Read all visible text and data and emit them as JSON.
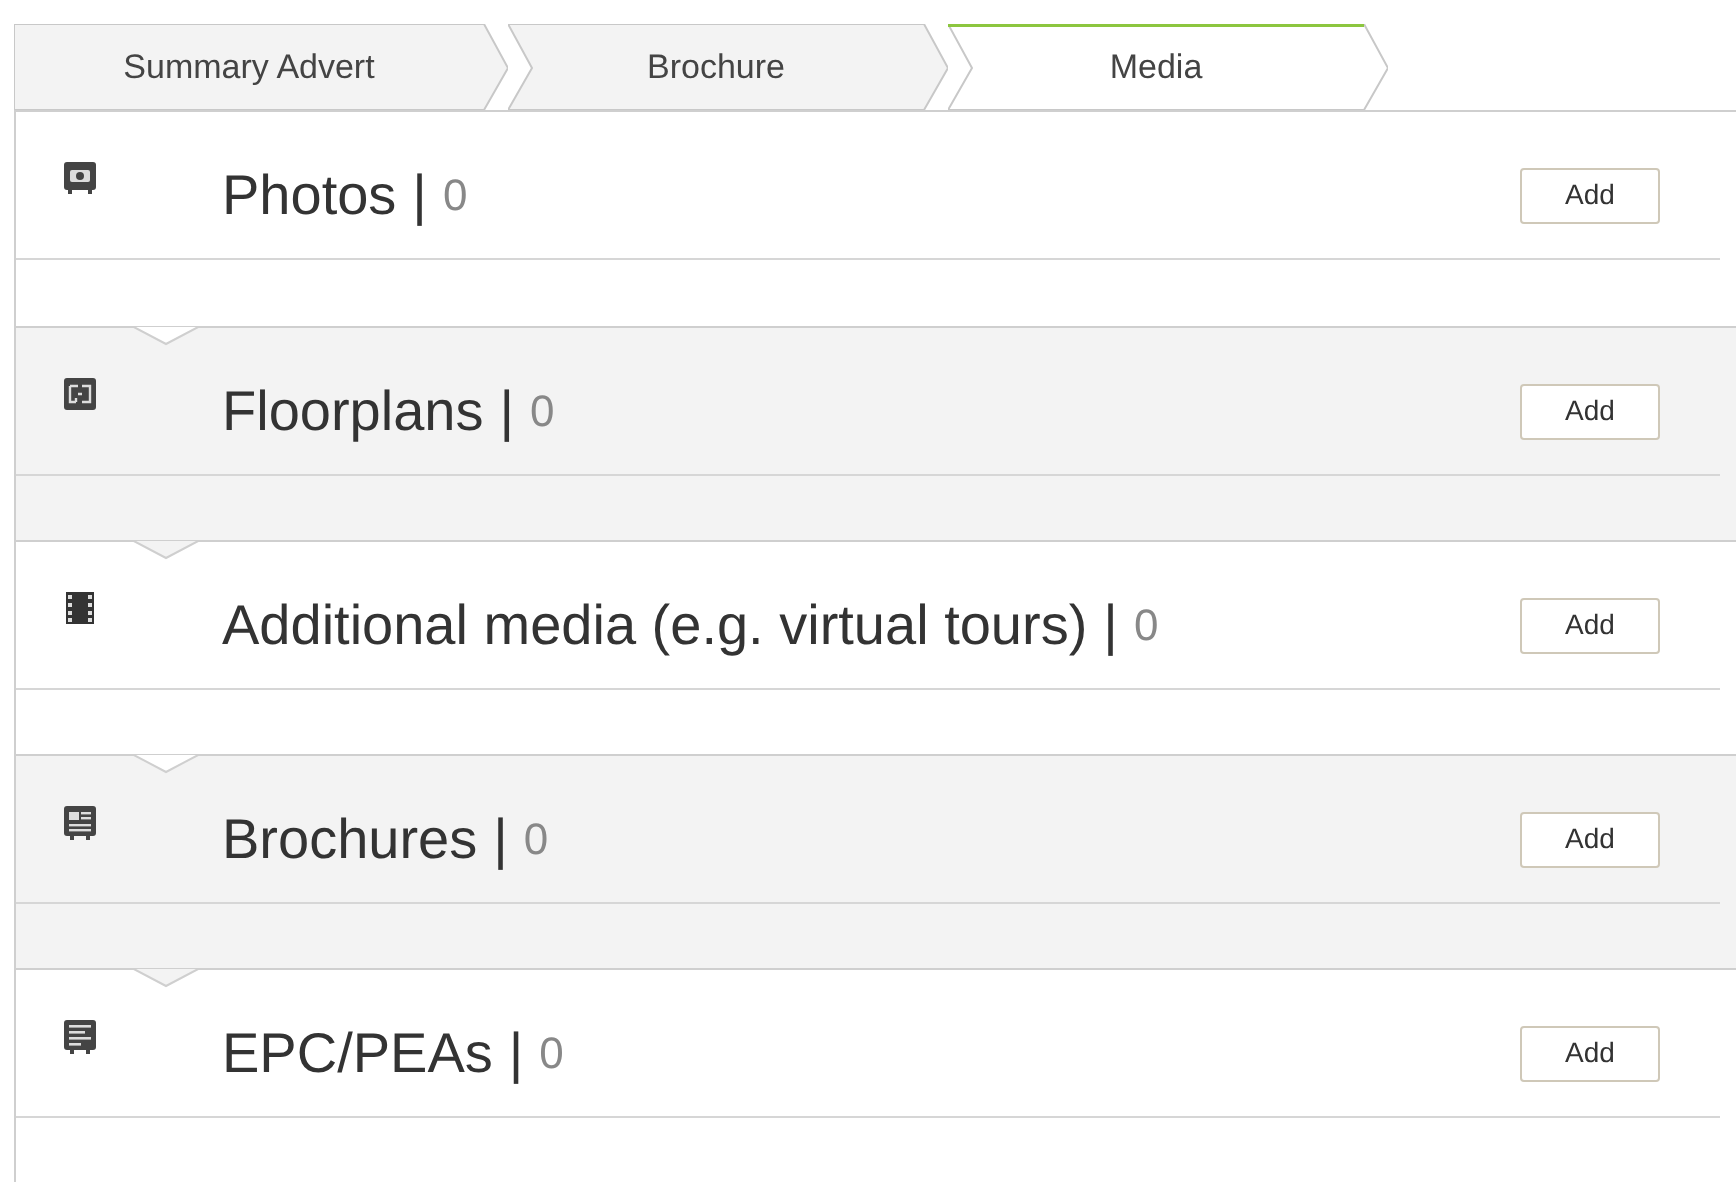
{
  "tabs": [
    {
      "label": "Summary Advert",
      "selected": false
    },
    {
      "label": "Brochure",
      "selected": false
    },
    {
      "label": "Media",
      "selected": true
    }
  ],
  "sections": [
    {
      "kind": "photos",
      "title": "Photos",
      "separator": "|",
      "count": "0",
      "button": "Add"
    },
    {
      "kind": "floorplans",
      "title": "Floorplans",
      "separator": "|",
      "count": "0",
      "button": "Add"
    },
    {
      "kind": "media",
      "title": "Additional media (e.g. virtual tours)",
      "separator": "|",
      "count": "0",
      "button": "Add"
    },
    {
      "kind": "brochures",
      "title": "Brochures",
      "separator": "|",
      "count": "0",
      "button": "Add"
    },
    {
      "kind": "epc",
      "title": "EPC/PEAs",
      "separator": "|",
      "count": "0",
      "button": "Add"
    }
  ]
}
